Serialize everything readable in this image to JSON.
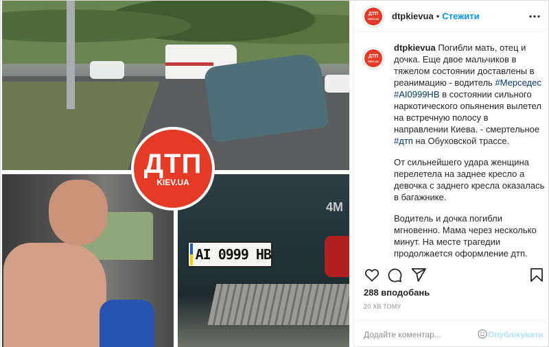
{
  "post": {
    "media": {
      "watermark_top": "ДТП",
      "watermark_bottom": "KIEV.UA",
      "plate_text": "AI 0999 HB",
      "car_badge": "4M"
    },
    "header": {
      "avatar_icon": "dtp-logo-icon",
      "username": "dtpkievua",
      "separator": "•",
      "follow_label": "Стежити",
      "more_icon": "more-options-icon"
    },
    "caption": {
      "username": "dtpkievua",
      "p1_text_a": "Погибли мать, отец и дочка. Еще двое мальчиков в тяжелом состоянии доставлены в реанимацию - водитель ",
      "hashtag_mercedes": "#Мерседес",
      "p1_text_b": " ",
      "hashtag_plate": "#AI0999HB",
      "p1_text_c": " в состоянии сильного наркотического опьянения вылетел на встречную полосу в направлении Киева. - смертельное ",
      "hashtag_dtp": "#дтп",
      "p1_text_d": " на Обуховской трассе.",
      "p2": "От сильнейшего удара женщина перелетела на заднее кресло а девочка с заднего кресла оказалась в багажнике.",
      "p3": "Водитель и дочка погибли мгновенно. Мама через несколько минут. На месте трагедии продолжается оформление дтп."
    },
    "actions": {
      "like_icon": "heart-icon",
      "comment_icon": "comment-icon",
      "share_icon": "share-icon",
      "save_icon": "bookmark-icon"
    },
    "likes": "288 вподобань",
    "time": "20 ХВ ТОМУ",
    "comment": {
      "placeholder": "Додайте коментар...",
      "emoji_icon": "emoji-icon",
      "publish_label": "Опублікувати"
    }
  },
  "colors": {
    "accent": "#0095f6",
    "link": "#00376b",
    "logo_red": "#e53b26",
    "muted": "#8e8e8e",
    "publish_disabled": "#b2dffc"
  }
}
